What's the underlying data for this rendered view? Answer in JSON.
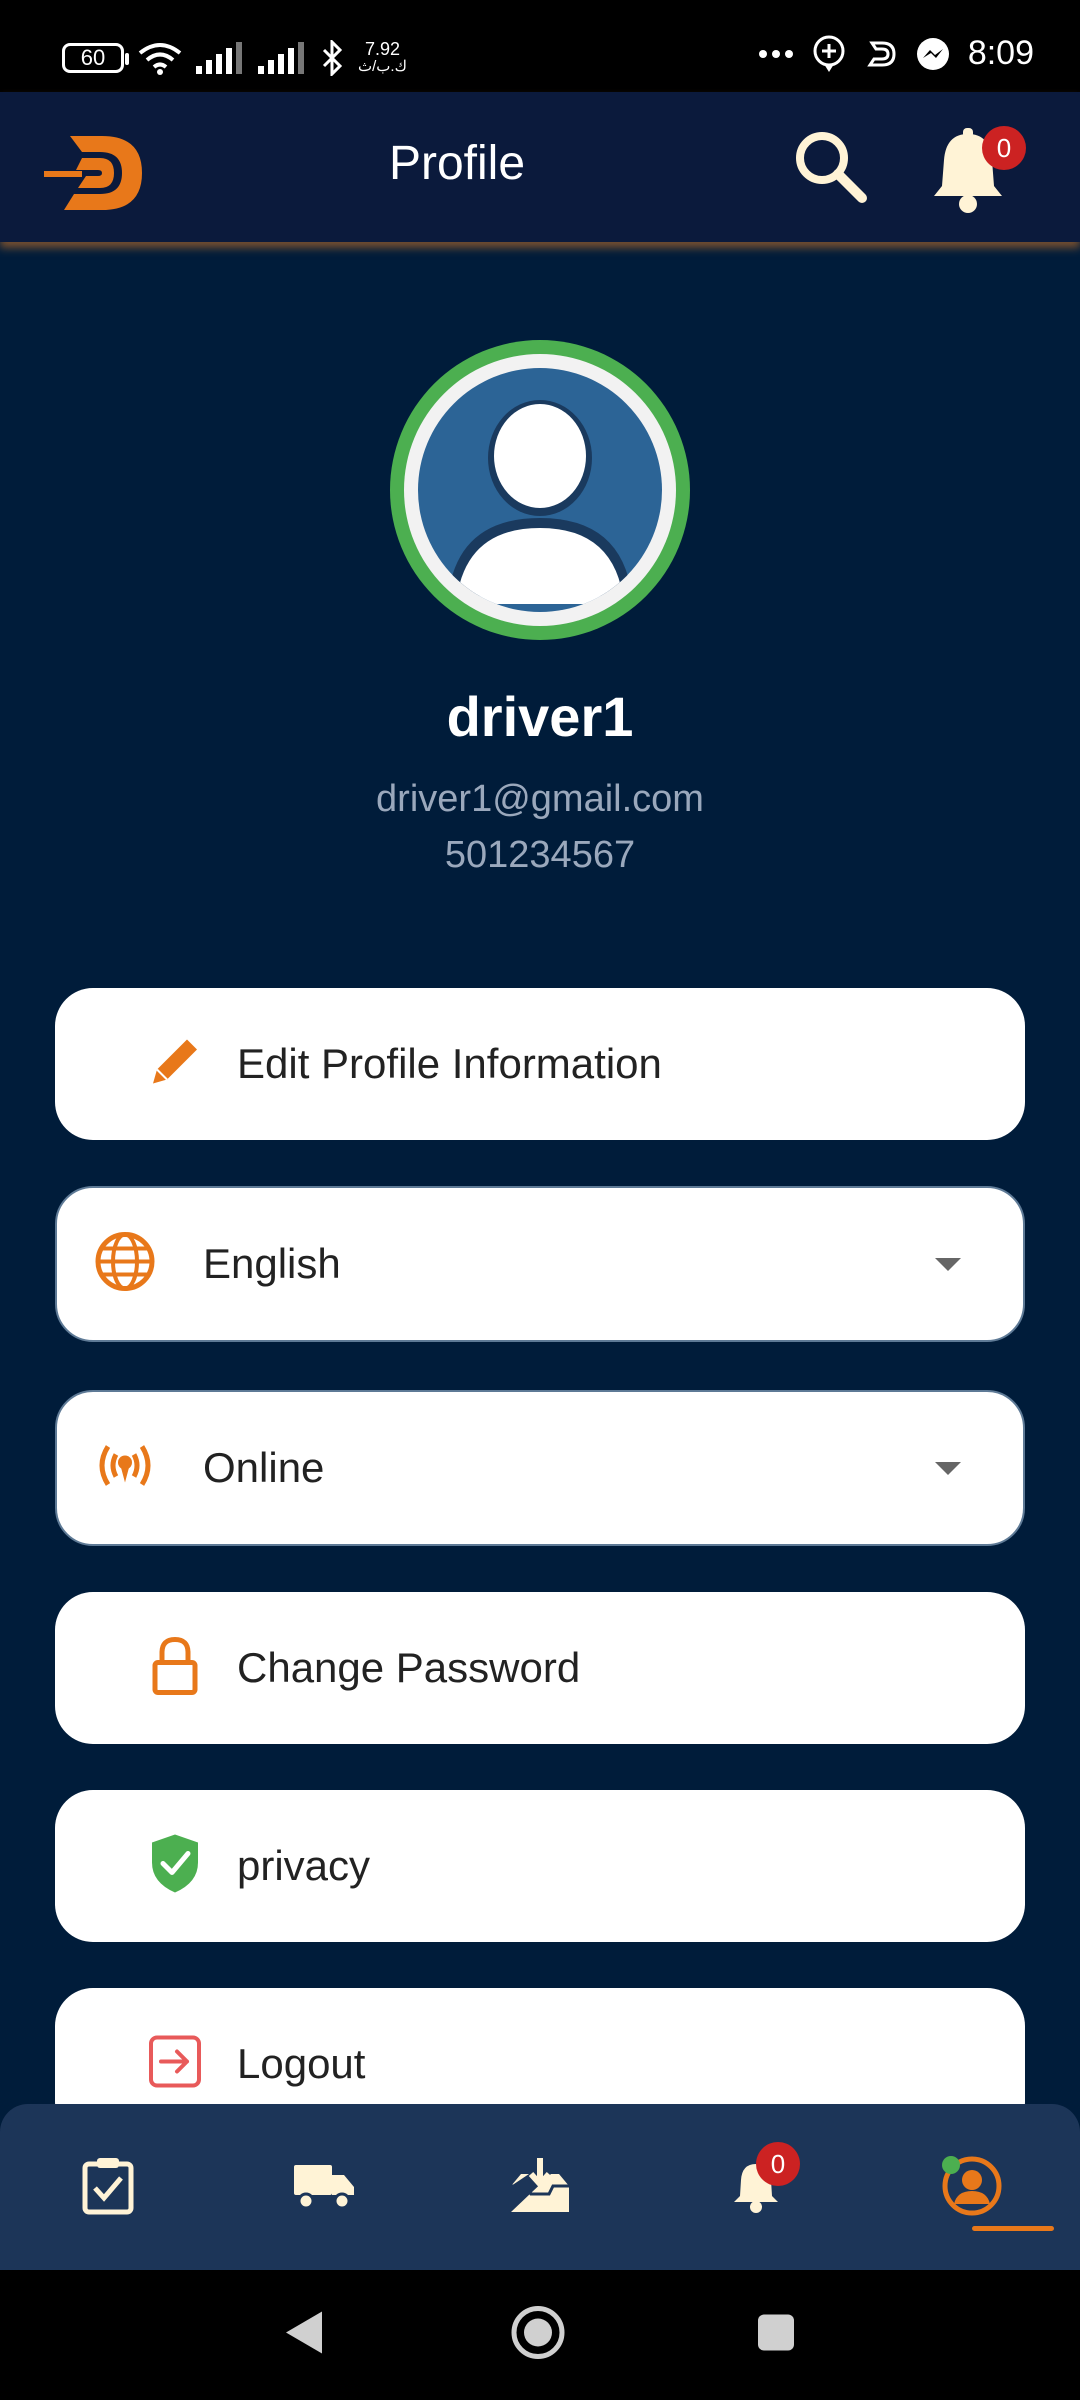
{
  "status_bar": {
    "battery": "60",
    "net_speed": "7.92",
    "net_unit": "ك.ب/ث",
    "time": "8:09"
  },
  "header": {
    "title": "Profile",
    "notification_count": "0"
  },
  "profile": {
    "name": "driver1",
    "email": "driver1@gmail.com",
    "phone": "501234567"
  },
  "menu": {
    "edit_profile": "Edit Profile Information",
    "language": "English",
    "status": "Online",
    "change_password": "Change Password",
    "privacy": "privacy",
    "logout": "Logout"
  },
  "bottom_nav": {
    "notification_count": "0",
    "active_tab": "profile"
  },
  "colors": {
    "background": "#001c3a",
    "header": "#0b1a3c",
    "accent": "#e8781a",
    "avatar_ring": "#4caf50",
    "badge": "#cc2222",
    "bottom_nav": "#1c3558"
  }
}
